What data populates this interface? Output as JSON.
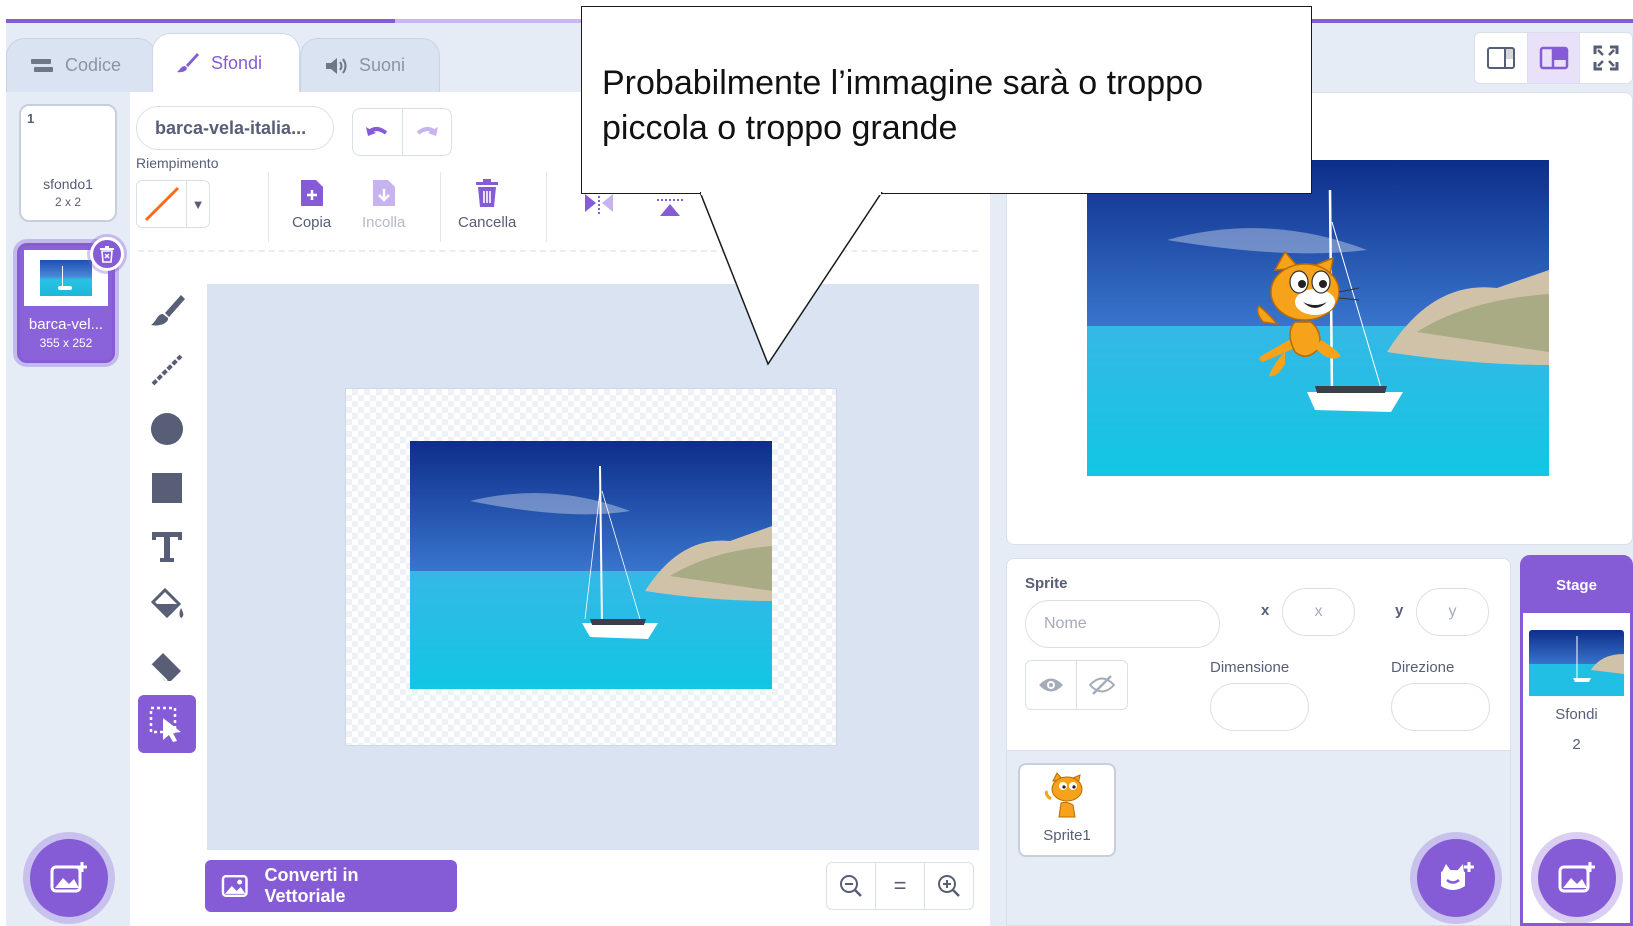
{
  "tabs": [
    {
      "label": "Codice",
      "icon": "code-icon"
    },
    {
      "label": "Sfondi",
      "icon": "brush-icon"
    },
    {
      "label": "Suoni",
      "icon": "sound-icon"
    }
  ],
  "costumes": [
    {
      "number": "1",
      "name": "sfondo1",
      "size": "2 x 2"
    },
    {
      "number": "2",
      "name": "barca-vel...",
      "size": "355 x 252"
    }
  ],
  "editor": {
    "costume_name": "barca-vela-italia...",
    "fill_label": "Riempimento",
    "fill_color": "#ff6a1a",
    "copy_label": "Copia",
    "paste_label": "Incolla",
    "delete_label": "Cancella",
    "convert_label": "Converti in Vettoriale",
    "zoom_reset": "="
  },
  "toolbox": [
    "brush-icon",
    "line-icon",
    "circle-icon",
    "rectangle-icon",
    "text-icon",
    "fill-icon",
    "eraser-icon",
    "select-icon"
  ],
  "sprite_info": {
    "title": "Sprite",
    "name_placeholder": "Nome",
    "x_label": "x",
    "x_placeholder": "x",
    "y_label": "y",
    "y_placeholder": "y",
    "size_label": "Dimensione",
    "direction_label": "Direzione"
  },
  "sprites": [
    {
      "name": "Sprite1"
    }
  ],
  "stage_selector": {
    "title": "Stage",
    "backdrops_label": "Sfondi",
    "backdrops_count": "2"
  },
  "callout": {
    "text": "Probabilmente l’immagine sarà o troppo piccola o troppo grande"
  },
  "colors": {
    "accent": "#855cd6",
    "panel": "#e6ecf6",
    "text": "#575e75"
  }
}
